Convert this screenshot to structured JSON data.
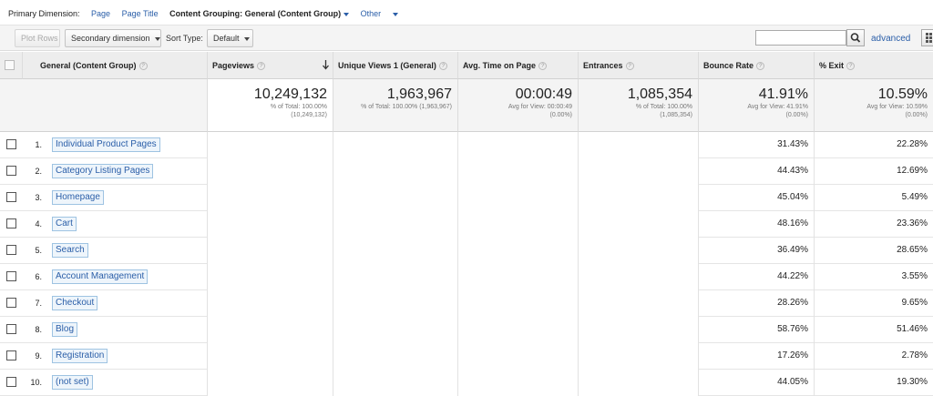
{
  "primary_dimension": {
    "label": "Primary Dimension:",
    "page": "Page",
    "page_title": "Page Title",
    "content_grouping": "Content Grouping: General (Content Group)",
    "other": "Other"
  },
  "toolbar": {
    "plot_rows": "Plot Rows",
    "secondary_dimension": "Secondary dimension",
    "sort_type_label": "Sort Type:",
    "sort_type_value": "Default",
    "search_value": "",
    "advanced": "advanced"
  },
  "columns": {
    "dimension": "General (Content Group)",
    "pageviews": "Pageviews",
    "unique_views": "Unique Views 1 (General)",
    "avg_time": "Avg. Time on Page",
    "entrances": "Entrances",
    "bounce_rate": "Bounce Rate",
    "exit": "% Exit"
  },
  "totals": {
    "pageviews": {
      "value": "10,249,132",
      "sub1": "% of Total: 100.00%",
      "sub2": "(10,249,132)"
    },
    "unique_views": {
      "value": "1,963,967",
      "sub1": "% of Total: 100.00% (1,963,967)",
      "sub2": ""
    },
    "avg_time": {
      "value": "00:00:49",
      "sub1": "Avg for View: 00:00:49",
      "sub2": "(0.00%)"
    },
    "entrances": {
      "value": "1,085,354",
      "sub1": "% of Total: 100.00%",
      "sub2": "(1,085,354)"
    },
    "bounce_rate": {
      "value": "41.91%",
      "sub1": "Avg for View: 41.91%",
      "sub2": "(0.00%)"
    },
    "exit": {
      "value": "10.59%",
      "sub1": "Avg for View: 10.59%",
      "sub2": "(0.00%)"
    }
  },
  "rows": [
    {
      "num": "1.",
      "name": "Individual Product Pages",
      "bounce": "31.43%",
      "exit": "22.28%"
    },
    {
      "num": "2.",
      "name": "Category Listing Pages",
      "bounce": "44.43%",
      "exit": "12.69%"
    },
    {
      "num": "3.",
      "name": "Homepage",
      "bounce": "45.04%",
      "exit": "5.49%"
    },
    {
      "num": "4.",
      "name": "Cart",
      "bounce": "48.16%",
      "exit": "23.36%"
    },
    {
      "num": "5.",
      "name": "Search",
      "bounce": "36.49%",
      "exit": "28.65%"
    },
    {
      "num": "6.",
      "name": "Account Management",
      "bounce": "44.22%",
      "exit": "3.55%"
    },
    {
      "num": "7.",
      "name": "Checkout",
      "bounce": "28.26%",
      "exit": "9.65%"
    },
    {
      "num": "8.",
      "name": "Blog",
      "bounce": "58.76%",
      "exit": "51.46%"
    },
    {
      "num": "9.",
      "name": "Registration",
      "bounce": "17.26%",
      "exit": "2.78%"
    },
    {
      "num": "10.",
      "name": "(not set)",
      "bounce": "44.05%",
      "exit": "19.30%"
    }
  ]
}
